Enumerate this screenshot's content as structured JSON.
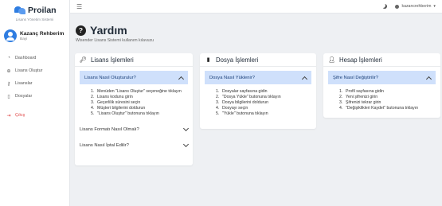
{
  "brand": {
    "name": "Proilan",
    "subtitle": "Lisans Yönetim Sistemi"
  },
  "user": {
    "name": "Kazanç Rehberim",
    "role": "Bayi"
  },
  "nav": [
    {
      "label": "Dashboard",
      "icon": "speedometer-icon"
    },
    {
      "label": "Lisans Oluştur",
      "icon": "plus-circle-icon"
    },
    {
      "label": "Lisanslar",
      "icon": "key-icon"
    },
    {
      "label": "Dosyalar",
      "icon": "file-icon"
    }
  ],
  "logout": {
    "label": "Çıkış",
    "icon": "logout-icon"
  },
  "topbar": {
    "username": "kazancrehberim"
  },
  "page": {
    "title": "Yardım",
    "subtitle": "Wisender Lisans Sistemi kullanım kılavuzu"
  },
  "cards": {
    "license": {
      "title": "Lisans İşlemleri",
      "open": {
        "question": "Lisans Nasıl Oluşturulur?",
        "steps": [
          "Menüden \"Lisans Oluştur\" seçeneğine tıklayın",
          "Lisans kodunu girin",
          "Geçerlilik süresini seçin",
          "Müşteri bilgilerini doldurun",
          "\"Lisans Oluştur\" butonuna tıklayın"
        ]
      },
      "closed": [
        "Lisans Formatı Nasıl Olmalı?",
        "Lisans Nasıl İptal Edilir?"
      ]
    },
    "file": {
      "title": "Dosya İşlemleri",
      "open": {
        "question": "Dosya Nasıl Yüklenir?",
        "steps": [
          "Dosyalar sayfasına gidin",
          "\"Dosya Yükle\" butonuna tıklayın",
          "Dosya bilgilerini doldurun",
          "Dosyayı seçin",
          "\"Yükle\" butonuna tıklayın"
        ]
      }
    },
    "account": {
      "title": "Hesap İşlemleri",
      "open": {
        "question": "Şifre Nasıl Değiştirilir?",
        "steps": [
          "Profil sayfasına gidin",
          "Yeni şifrenizi girin",
          "Şifrenizi tekrar girin",
          "\"Değişiklikleri Kaydet\" butonuna tıklayın"
        ]
      }
    }
  }
}
